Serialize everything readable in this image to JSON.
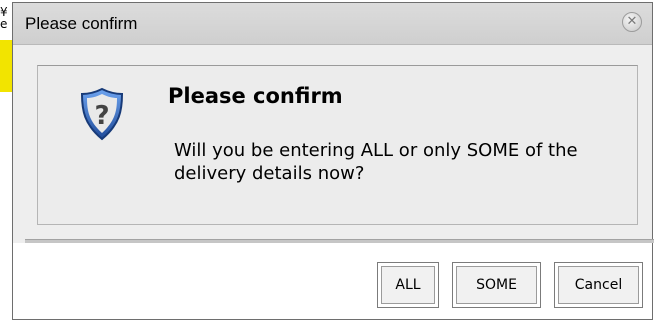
{
  "background": {
    "left_glyphs": "¥\ne"
  },
  "dialog": {
    "title": "Please confirm",
    "close_icon": "close-circle-icon",
    "heading": "Please confirm",
    "message": "Will you be entering ALL or only SOME of the delivery details now?",
    "icon": "question-shield-icon",
    "buttons": {
      "all": "ALL",
      "some": "SOME",
      "cancel": "Cancel"
    }
  },
  "colors": {
    "yellow_strip": "#f2e400",
    "dialog_bg": "#eeeeee",
    "shield_blue": "#2f5db2"
  }
}
